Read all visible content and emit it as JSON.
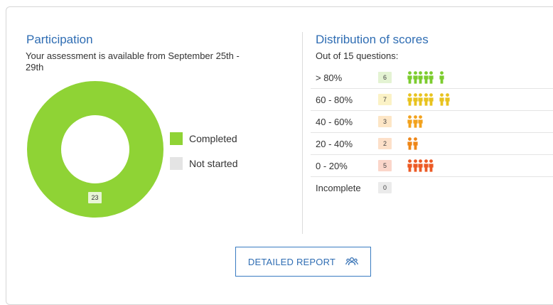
{
  "participation": {
    "title": "Participation",
    "subtitle_line1": "Your assessment is available from September 25th -",
    "subtitle_line2": "29th",
    "completed_count": "23",
    "completed_value": 23,
    "not_started_value": 0,
    "legend": {
      "completed": "Completed",
      "not_started": "Not started"
    },
    "colors": {
      "completed": "#8fd335",
      "not_started": "#e4e4e4"
    }
  },
  "distribution": {
    "title": "Distribution of scores",
    "subtitle": "Out of 15 questions:",
    "rows": [
      {
        "range": "> 80%",
        "count": "6",
        "value": 6,
        "badge_bg": "#e4f3d3",
        "color": "#7ccc2e"
      },
      {
        "range": "60 - 80%",
        "count": "7",
        "value": 7,
        "badge_bg": "#fbf2c6",
        "color": "#e8c31e"
      },
      {
        "range": "40 - 60%",
        "count": "3",
        "value": 3,
        "badge_bg": "#fde6c6",
        "color": "#f2a21d"
      },
      {
        "range": "20 - 40%",
        "count": "2",
        "value": 2,
        "badge_bg": "#fde0c9",
        "color": "#ee8617"
      },
      {
        "range": "0 - 20%",
        "count": "5",
        "value": 5,
        "badge_bg": "#fbd6ca",
        "color": "#ec5a25"
      },
      {
        "range": "Incomplete",
        "count": "0",
        "value": 0,
        "badge_bg": "#ebebeb",
        "color": "#cccccc"
      }
    ]
  },
  "detailed_report": {
    "label": "DETAILED REPORT",
    "icon": "group-icon"
  }
}
